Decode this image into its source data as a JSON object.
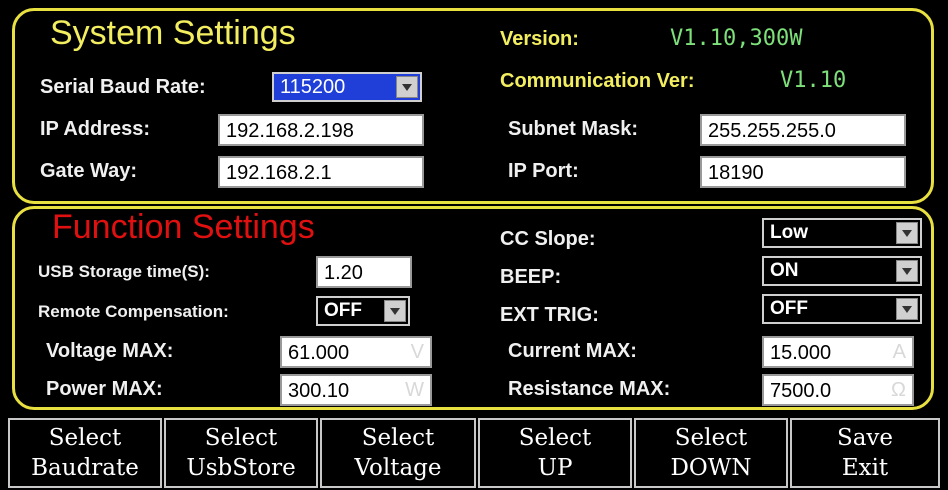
{
  "system": {
    "title": "System Settings",
    "version_label": "Version:",
    "version_value": "V1.10,300W",
    "comm_label": "Communication Ver:",
    "comm_value": "V1.10",
    "baud_label": "Serial Baud Rate:",
    "baud_value": "115200",
    "ip_label": "IP Address:",
    "ip_value": "192.168.2.198",
    "subnet_label": "Subnet Mask:",
    "subnet_value": "255.255.255.0",
    "gateway_label": "Gate Way:",
    "gateway_value": "192.168.2.1",
    "port_label": "IP Port:",
    "port_value": "18190"
  },
  "function": {
    "title": "Function Settings",
    "usb_label": "USB Storage time(S):",
    "usb_value": "1.20",
    "remote_label": "Remote Compensation:",
    "remote_value": "OFF",
    "vmax_label": "Voltage MAX:",
    "vmax_value": "61.000",
    "vmax_unit": "V",
    "pmax_label": "Power MAX:",
    "pmax_value": "300.10",
    "pmax_unit": "W",
    "ccslope_label": "CC Slope:",
    "ccslope_value": "Low",
    "beep_label": "BEEP:",
    "beep_value": "ON",
    "exttrig_label": "EXT TRIG:",
    "exttrig_value": "OFF",
    "imax_label": "Current MAX:",
    "imax_value": "15.000",
    "imax_unit": "A",
    "rmax_label": "Resistance MAX:",
    "rmax_value": "7500.0",
    "rmax_unit": "Ω"
  },
  "softkeys": [
    {
      "line1": "Select",
      "line2": "Baudrate"
    },
    {
      "line1": "Select",
      "line2": "UsbStore"
    },
    {
      "line1": "Select",
      "line2": "Voltage"
    },
    {
      "line1": "Select",
      "line2": "UP"
    },
    {
      "line1": "Select",
      "line2": "DOWN"
    },
    {
      "line1": "Save",
      "line2": "Exit"
    }
  ],
  "colors": {
    "panel_border": "#e8e040",
    "title_yellow": "#f2ee60",
    "title_red": "#e01010",
    "value_green": "#7de07a",
    "selected_blue": "#1f3fd8"
  }
}
